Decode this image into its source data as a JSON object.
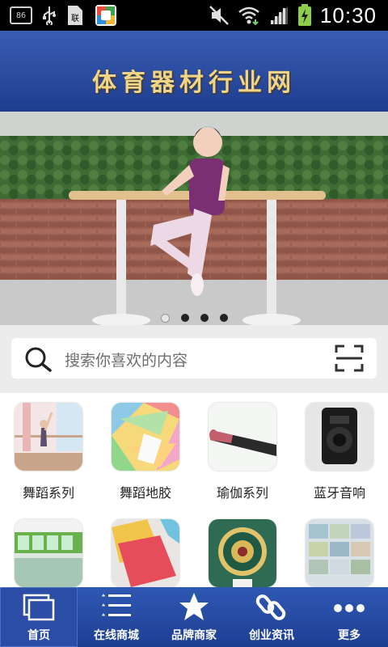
{
  "status_bar": {
    "notification_badge": "86",
    "time": "10:30"
  },
  "header": {
    "title": "体育器材行业网"
  },
  "banner": {
    "dot_count": 4,
    "active_dot": 1
  },
  "search": {
    "placeholder": "搜索你喜欢的内容"
  },
  "categories": [
    {
      "label": "舞蹈系列"
    },
    {
      "label": "舞蹈地胶"
    },
    {
      "label": "瑜伽系列"
    },
    {
      "label": "蓝牙音响"
    },
    {
      "label": ""
    },
    {
      "label": ""
    },
    {
      "label": ""
    },
    {
      "label": ""
    }
  ],
  "bottom_nav": [
    {
      "label": "首页",
      "icon": "home-window-icon",
      "active": true
    },
    {
      "label": "在线商城",
      "icon": "list-icon",
      "active": false
    },
    {
      "label": "品牌商家",
      "icon": "star-icon",
      "active": false
    },
    {
      "label": "创业资讯",
      "icon": "link-icon",
      "active": false
    },
    {
      "label": "更多",
      "icon": "more-dots-icon",
      "active": false
    }
  ],
  "colors": {
    "header_blue": "#2a4ca3",
    "title_gold": "#f0d487",
    "nav_blue": "#2a4ca3"
  }
}
